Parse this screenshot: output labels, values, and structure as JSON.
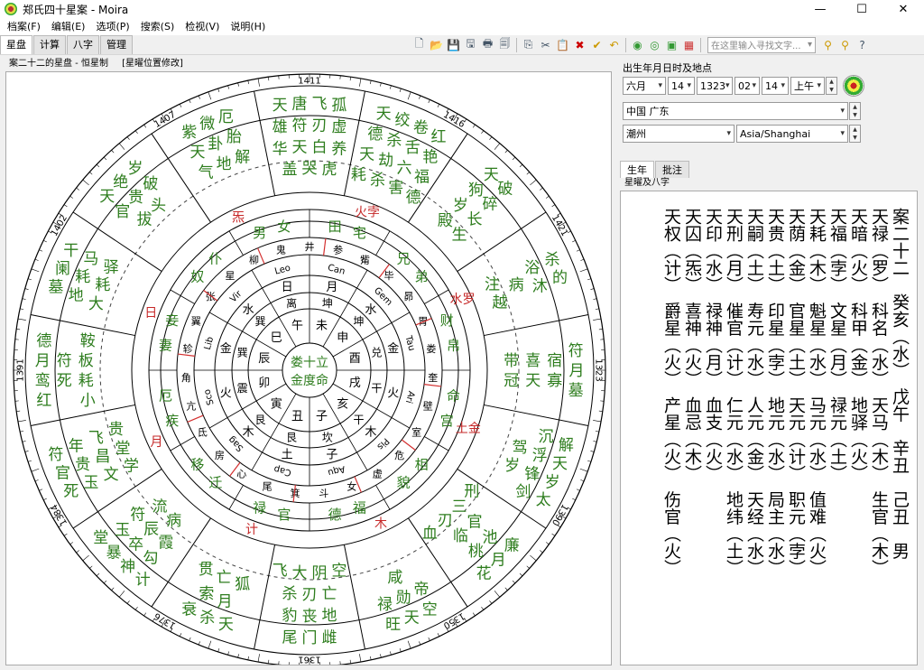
{
  "window": {
    "title": "郑氏四十星案 - Moira",
    "min": "—",
    "max": "☐",
    "close": "✕"
  },
  "menu": [
    "档案(F)",
    "编辑(E)",
    "选项(P)",
    "搜索(S)",
    "检视(V)",
    "说明(H)"
  ],
  "tabs": [
    "星盘",
    "计算",
    "八字",
    "管理"
  ],
  "search": {
    "placeholder": "在这里输入寻找文字..."
  },
  "chart_header": {
    "title": "案二十二的星盘 - 恒星制",
    "mode": "[星曜位置修改]"
  },
  "birth": {
    "section": "出生年月日时及地点",
    "month": "六月",
    "day": "14",
    "year": "1323",
    "hour": "02",
    "minute": "14",
    "ampm": "上午",
    "country": "中国 广东",
    "city": "潮州",
    "tz": "Asia/Shanghai"
  },
  "right_tabs": [
    "生年",
    "批注"
  ],
  "section_title": "星曜及八字",
  "text_lines": [
    "案二十二　癸亥（水）　戊午　辛丑　己丑　男",
    "天禄（罗）　科名（水）　天马（木）　生官（木）",
    "天暗（火）　科甲（金）　地驿（火）",
    "天福（孛）　文星（月）　禄元（土）",
    "天耗（木）　魁星（水）　马元（水）　值难（火）",
    "天荫（金）　官星（土）　天元（计）　职元（孛）",
    "天贵（土）　印星（孛）　地元（水）　局主（水）",
    "天嗣（土）　寿元（水）　人元（金）　天经（水）",
    "天刑（月）　催官（计）　仁元（水）　地纬（土）",
    "天印（水）　禄神（月）　血支（火）",
    "天囚（炁）　喜神（火）　血忌（木）",
    "天权（计）　爵星（火）　产星（火）　伤官（火）"
  ],
  "chart": {
    "ticks": [
      "1411",
      "1416",
      "1421",
      "1323",
      "1390",
      "1350",
      "1361",
      "1376",
      "1384",
      "1391",
      "1402",
      "1407"
    ],
    "center": [
      "娄十立",
      "金度命"
    ],
    "signs": [
      "Can",
      "Gem",
      "Tau",
      "Ari",
      "Pis",
      "Aqu",
      "Cap",
      "Sag",
      "Sco",
      "Lib",
      "Vir",
      "Leo"
    ],
    "branches": [
      "未",
      "申",
      "酉",
      "戌",
      "亥",
      "子",
      "丑",
      "寅",
      "卯",
      "辰",
      "巳",
      "午"
    ],
    "trigrams": [
      "坤",
      "坤",
      "兑",
      "干",
      "干",
      "坎",
      "艮",
      "艮",
      "震",
      "巽",
      "巽",
      "离"
    ],
    "planets": [
      "月",
      "水",
      "金",
      "火",
      "木",
      "子",
      "土",
      "木",
      "火",
      "金",
      "水",
      "日"
    ],
    "mansions": [
      "井",
      "参",
      "觜",
      "毕",
      "昴",
      "胃",
      "娄",
      "奎",
      "壁",
      "室",
      "危",
      "虚",
      "女",
      "斗",
      "箕",
      "尾",
      "心",
      "房",
      "氐",
      "亢",
      "角",
      "轸",
      "翼",
      "张",
      "星",
      "柳",
      "鬼"
    ],
    "palaces": [
      "田宅",
      "兄弟",
      "财帛",
      "命宫",
      "相貌",
      "福德",
      "官禄",
      "迁移",
      "疾厄",
      "妻妾",
      "奴仆",
      "男女"
    ],
    "ring2": [
      "火孛",
      "水罗",
      "土金",
      "木",
      "计",
      "月",
      "日",
      "炁"
    ],
    "sectors": [
      "天唐飞孤\n雄符刃虚\n华天白养\n盖哭虎",
      "天绞卷红\n德杀舌艳\n天劫六福\n耗杀害德",
      "天破\n狗碎\n岁长\n殿生",
      "杀的\n浴沐\n病\n注越",
      "符月墓\n宿寡\n喜天\n带冠",
      "解天岁太\n沉浮锋剑\n驾岁",
      "廉月花\n池桃\n官临\n刑三刃血",
      "空天旺\n帝勋禄\n咸",
      "雌门尾\n地丧豹\n亡刃杀\n空阴大飞",
      "天杀衰\n月索\n狐亡贯",
      "计神暴堂\n勾卒玉\n霞辰符\n病流",
      "死官符\n玉贵年\n文昌飞\n学堂贵",
      "红鸾月德\n死符\n小耗板鞍",
      "墓阑干\n地耗马\n大耗驿",
      "天绝岁\n官贵破\n拔头",
      "紫微厄\n天卦胎\n气地解"
    ]
  }
}
